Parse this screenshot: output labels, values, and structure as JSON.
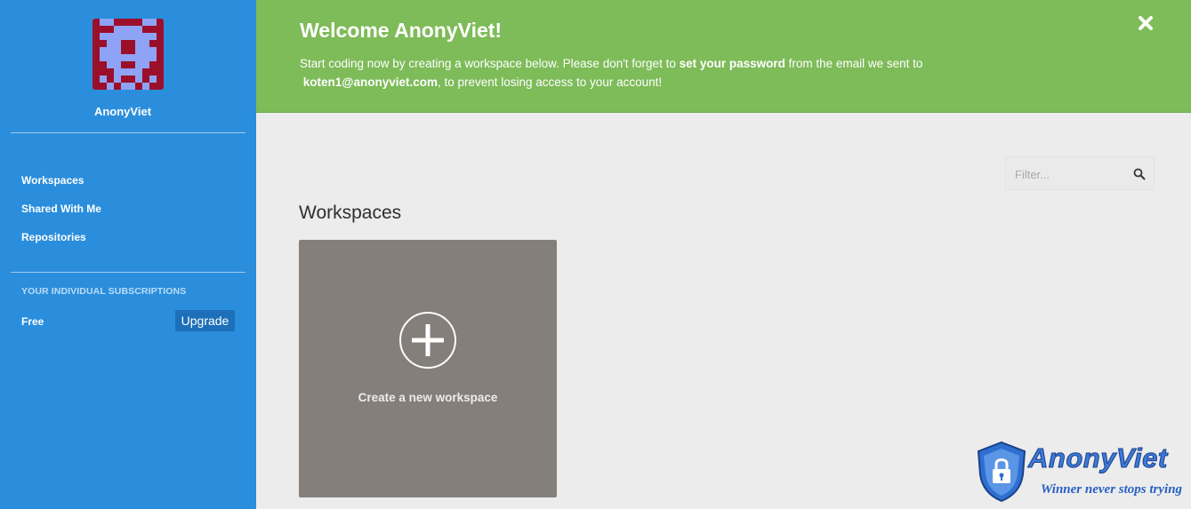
{
  "sidebar": {
    "username": "AnonyViet",
    "nav": [
      {
        "label": "Workspaces"
      },
      {
        "label": "Shared With Me"
      },
      {
        "label": "Repositories"
      }
    ],
    "subscriptions_heading": "YOUR INDIVIDUAL SUBSCRIPTIONS",
    "plan": "Free",
    "upgrade_label": "Upgrade"
  },
  "banner": {
    "title": "Welcome AnonyViet!",
    "text_1": "Start coding now by creating a workspace below. Please don't forget to ",
    "text_bold_1": "set your password",
    "text_2": " from the email we sent to",
    "email": "koten1@anonyviet.com",
    "text_3": ", to prevent losing access to your account!",
    "close_icon": "close-icon"
  },
  "main": {
    "filter_placeholder": "Filter...",
    "section_title": "Workspaces",
    "create_card_label": "Create a new workspace"
  },
  "watermark": {
    "brand": "AnonyViet",
    "slogan": "Winner never stops trying"
  },
  "colors": {
    "sidebar": "#2a8edc",
    "banner": "#7ebb59",
    "card": "#847f7b",
    "upgrade_button": "#1c6fb8"
  }
}
